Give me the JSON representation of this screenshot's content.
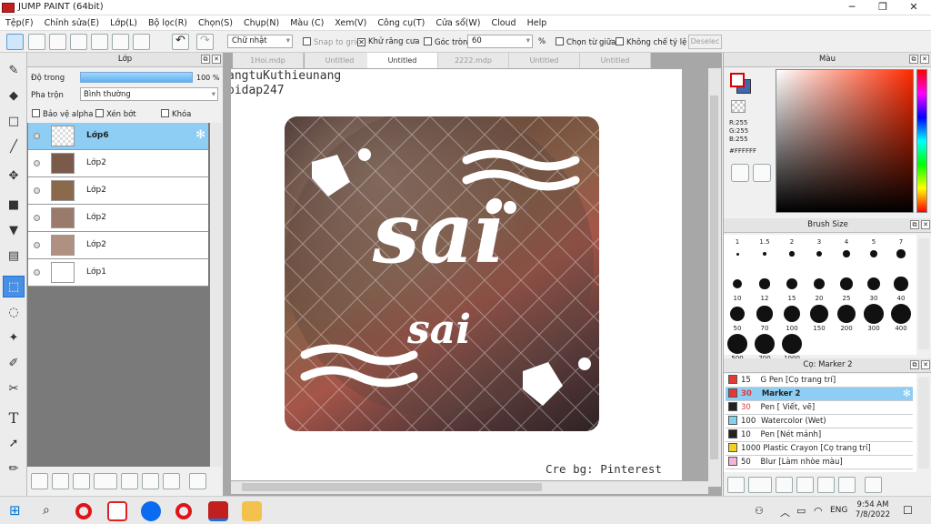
{
  "window": {
    "title": "JUMP PAINT (64bit)",
    "minimize": "─",
    "restore": "❐",
    "close": "✕"
  },
  "menu": [
    "Tệp(F)",
    "Chỉnh sửa(E)",
    "Lớp(L)",
    "Bộ lọc(R)",
    "Chọn(S)",
    "Chụp(N)",
    "Màu (C)",
    "Xem(V)",
    "Công cụ(T)",
    "Cửa sổ(W)",
    "Cloud",
    "Help"
  ],
  "toolbar": {
    "shape_select": "Chữ nhật",
    "snap_to_grid": "Snap to grid",
    "antialias": "Khử răng cưa",
    "round_corner": "Góc tròn",
    "round_value": "60",
    "percent": "%",
    "select_middle": "Chọn từ giữa",
    "no_ratio": "Không chế tỷ lệ",
    "deselect": "Deselec"
  },
  "layer_panel": {
    "title": "Lớp",
    "opacity_label": "Độ trong",
    "opacity_value": "100 %",
    "opacity_fraction": 1.0,
    "blend_label": "Pha trộn",
    "blend_value": "Bình thường",
    "protect_alpha": "Bảo vệ alpha",
    "clipping": "Xén bớt",
    "lock": "Khóa",
    "layers": [
      {
        "name": "Lớp6",
        "selected": true
      },
      {
        "name": "Lớp2",
        "selected": false
      },
      {
        "name": "Lớp2",
        "selected": false
      },
      {
        "name": "Lớp2",
        "selected": false
      },
      {
        "name": "Lớp2",
        "selected": false
      },
      {
        "name": "Lớp1",
        "selected": false
      }
    ]
  },
  "canvas": {
    "tabs": [
      "1Hoi.mdp",
      "Untitled",
      "Untitled",
      "2222.mdp",
      "Untitled",
      "Untitled"
    ],
    "active_tab": 2,
    "text_line1": "angtuKuthieunang",
    "text_line2": "oidap247",
    "big_word": "sai",
    "small_word": "sai",
    "credit": "Cre bg: Pinterest"
  },
  "color_panel": {
    "title": "Màu",
    "r": "R:255",
    "g": "G:255",
    "b": "B:255",
    "hex": "#FFFFFF"
  },
  "brush_size_panel": {
    "title": "Brush Size",
    "sizes": [
      "1",
      "1.5",
      "2",
      "3",
      "4",
      "5",
      "7",
      "10",
      "12",
      "15",
      "20",
      "25",
      "30",
      "40",
      "50",
      "70",
      "100",
      "150",
      "200",
      "300",
      "400",
      "500",
      "700",
      "1000"
    ]
  },
  "brush_panel": {
    "title": "Cọ: Marker 2",
    "brushes": [
      {
        "size": "15",
        "name": "G Pen [Cọ trang trí]",
        "color": "#e53935"
      },
      {
        "size": "30",
        "name": "Marker 2",
        "color": "#e53935"
      },
      {
        "size": "30",
        "name": "Pen [ Viết, vẽ]",
        "color": "#222222"
      },
      {
        "size": "100",
        "name": "Watercolor (Wet)",
        "color": "#7fd3f0"
      },
      {
        "size": "10",
        "name": "Pen [Nét mảnh]",
        "color": "#222222"
      },
      {
        "size": "1000",
        "name": "Plastic Crayon [Cọ trang trí]",
        "color": "#f2d21b"
      },
      {
        "size": "50",
        "name": "Blur [Làm nhòe màu]",
        "color": "#f3b4d8"
      }
    ]
  },
  "taskbar": {
    "language": "ENG",
    "time": "9:54 AM",
    "date": "7/8/2022"
  }
}
